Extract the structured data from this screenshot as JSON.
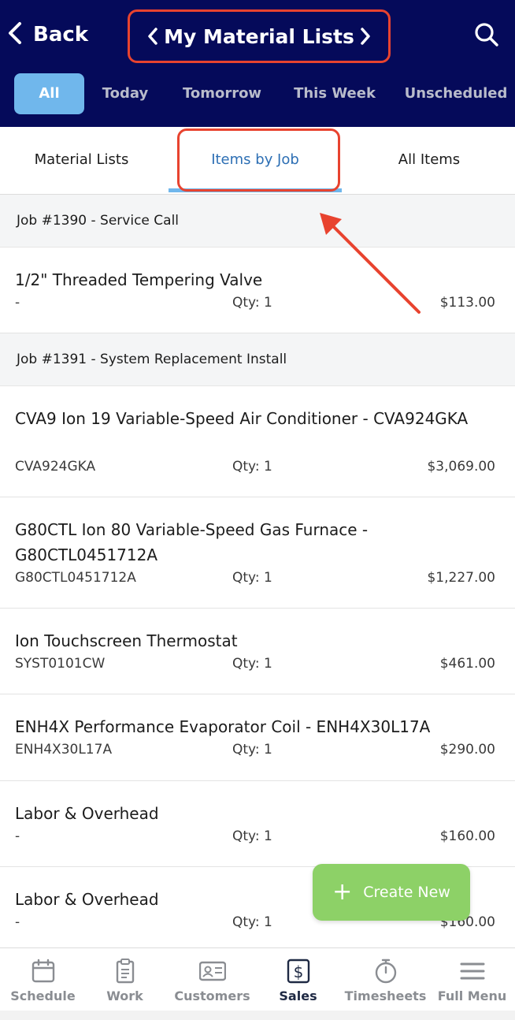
{
  "header": {
    "back_label": "Back",
    "title": "My Material Lists"
  },
  "filters": [
    {
      "label": "All",
      "active": true
    },
    {
      "label": "Today"
    },
    {
      "label": "Tomorrow"
    },
    {
      "label": "This Week"
    },
    {
      "label": "Unscheduled"
    }
  ],
  "subtabs": [
    {
      "label": "Material Lists"
    },
    {
      "label": "Items by Job",
      "active": true
    },
    {
      "label": "All Items"
    }
  ],
  "jobs": [
    {
      "header": "Job #1390 - Service Call",
      "items": [
        {
          "name": "1/2\" Threaded Tempering Valve",
          "sku": "-",
          "qty": "Qty: 1",
          "price": "$113.00"
        }
      ]
    },
    {
      "header": "Job #1391 - System Replacement Install",
      "items": [
        {
          "name": "CVA9 Ion 19 Variable-Speed Air Conditioner - CVA924GKA",
          "sku": "CVA924GKA",
          "qty": "Qty: 1",
          "price": "$3,069.00"
        },
        {
          "name": "G80CTL Ion 80 Variable-Speed Gas Furnace - G80CTL0451712A",
          "sku": "G80CTL0451712A",
          "qty": "Qty: 1",
          "price": "$1,227.00"
        },
        {
          "name": "Ion Touchscreen Thermostat",
          "sku": "SYST0101CW",
          "qty": "Qty: 1",
          "price": "$461.00"
        },
        {
          "name": "ENH4X Performance Evaporator Coil - ENH4X30L17A",
          "sku": "ENH4X30L17A",
          "qty": "Qty: 1",
          "price": "$290.00"
        },
        {
          "name": "Labor & Overhead",
          "sku": "-",
          "qty": "Qty: 1",
          "price": "$160.00"
        },
        {
          "name": "Labor & Overhead",
          "sku": "-",
          "qty": "Qty: 1",
          "price": "$160.00"
        }
      ]
    }
  ],
  "fab": {
    "plus": "+",
    "label": "Create New"
  },
  "bottom_nav": [
    {
      "label": "Schedule",
      "icon": "calendar-icon"
    },
    {
      "label": "Work",
      "icon": "clipboard-icon"
    },
    {
      "label": "Customers",
      "icon": "id-card-icon"
    },
    {
      "label": "Sales",
      "icon": "dollar-icon",
      "active": true
    },
    {
      "label": "Timesheets",
      "icon": "stopwatch-icon"
    },
    {
      "label": "Full Menu",
      "icon": "hamburger-icon"
    }
  ],
  "colors": {
    "header_bg": "#050a5a",
    "active_filter": "#70b7ec",
    "active_tab_text": "#2d6fb4",
    "annotation_red": "#e8432f",
    "fab_green": "#8dd167"
  }
}
